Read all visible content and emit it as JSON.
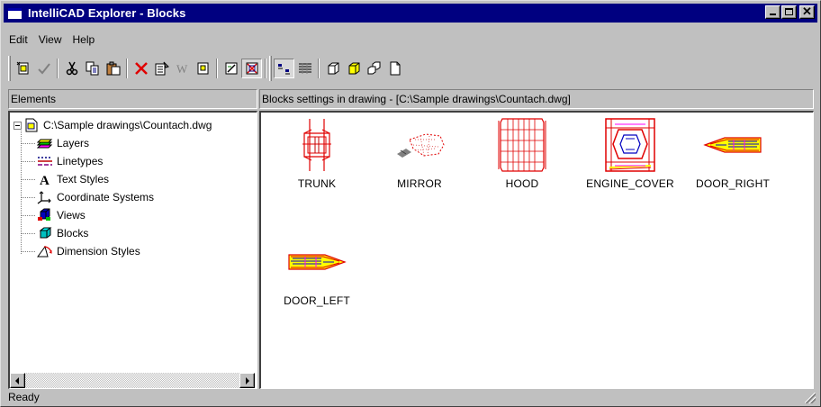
{
  "window": {
    "title": "IntelliCAD Explorer - Blocks"
  },
  "menu": [
    {
      "label": "Edit"
    },
    {
      "label": "View"
    },
    {
      "label": "Help"
    }
  ],
  "toolbar": {
    "buttons": [
      {
        "icon": "new-item-icon"
      },
      {
        "icon": "check-icon"
      },
      {
        "icon": "cut-icon"
      },
      {
        "icon": "copy-icon"
      },
      {
        "icon": "paste-icon"
      },
      {
        "icon": "delete-icon"
      },
      {
        "icon": "properties-icon"
      },
      {
        "icon": "wblock-icon"
      },
      {
        "icon": "insert-icon"
      },
      {
        "icon": "purge-icon"
      },
      {
        "icon": "purge-all-icon"
      },
      {
        "icon": "small-icons-view-icon"
      },
      {
        "icon": "details-view-icon"
      },
      {
        "icon": "block-view-icon"
      },
      {
        "icon": "block-current-icon"
      },
      {
        "icon": "block-insert-icon"
      },
      {
        "icon": "block-page-icon"
      }
    ]
  },
  "left_panel": {
    "header": "Elements",
    "tree": {
      "root": "C:\\Sample drawings\\Countach.dwg",
      "items": [
        {
          "label": "Layers",
          "icon": "layers-icon"
        },
        {
          "label": "Linetypes",
          "icon": "linetypes-icon"
        },
        {
          "label": "Text Styles",
          "icon": "text-styles-icon"
        },
        {
          "label": "Coordinate Systems",
          "icon": "coordinate-systems-icon"
        },
        {
          "label": "Views",
          "icon": "views-icon"
        },
        {
          "label": "Blocks",
          "icon": "blocks-icon"
        },
        {
          "label": "Dimension Styles",
          "icon": "dimension-styles-icon"
        }
      ]
    }
  },
  "right_panel": {
    "header": "Blocks settings in drawing - [C:\\Sample drawings\\Countach.dwg]",
    "blocks": [
      {
        "name": "TRUNK"
      },
      {
        "name": "MIRROR"
      },
      {
        "name": "HOOD"
      },
      {
        "name": "ENGINE_COVER"
      },
      {
        "name": "DOOR_RIGHT"
      },
      {
        "name": "DOOR_LEFT"
      }
    ]
  },
  "status": {
    "text": "Ready"
  }
}
